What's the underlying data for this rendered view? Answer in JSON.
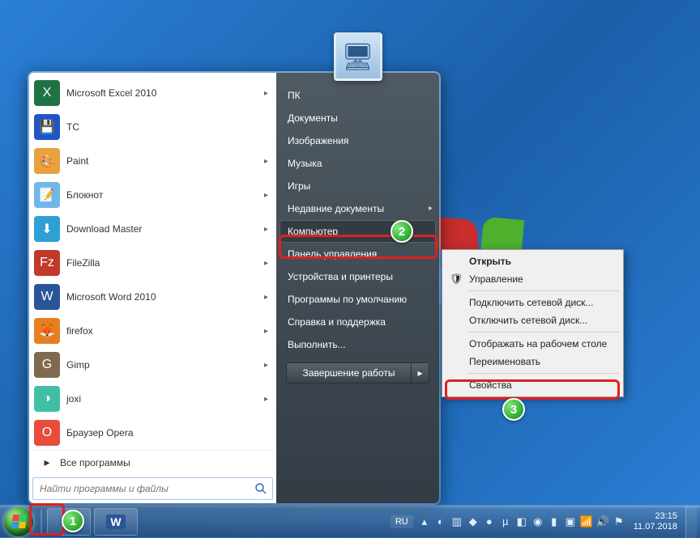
{
  "start_menu": {
    "programs": [
      {
        "label": "Microsoft Excel 2010",
        "icon_bg": "#1f7244",
        "icon_char": "X",
        "has_arrow": true
      },
      {
        "label": "TC",
        "icon_bg": "#1e55c7",
        "icon_char": "💾",
        "has_arrow": false
      },
      {
        "label": "Paint",
        "icon_bg": "#e8a13d",
        "icon_char": "🎨",
        "has_arrow": true
      },
      {
        "label": "Блокнот",
        "icon_bg": "#6fb7e8",
        "icon_char": "📝",
        "has_arrow": true
      },
      {
        "label": "Download Master",
        "icon_bg": "#2fa0d6",
        "icon_char": "⬇",
        "has_arrow": true
      },
      {
        "label": "FileZilla",
        "icon_bg": "#c0392b",
        "icon_char": "Fz",
        "has_arrow": true
      },
      {
        "label": "Microsoft Word 2010",
        "icon_bg": "#2a5699",
        "icon_char": "W",
        "has_arrow": true
      },
      {
        "label": "firefox",
        "icon_bg": "#e67e22",
        "icon_char": "🦊",
        "has_arrow": true
      },
      {
        "label": "Gimp",
        "icon_bg": "#7f6a4f",
        "icon_char": "G",
        "has_arrow": true
      },
      {
        "label": "joxi",
        "icon_bg": "#3fbfa6",
        "icon_char": "◑",
        "has_arrow": true
      },
      {
        "label": "Браузер Opera",
        "icon_bg": "#e74c3c",
        "icon_char": "O",
        "has_arrow": false
      }
    ],
    "all_programs_label": "Все программы",
    "search_placeholder": "Найти программы и файлы",
    "right_items": [
      {
        "label": "ПК",
        "highlighted": false
      },
      {
        "label": "Документы",
        "highlighted": false
      },
      {
        "label": "Изображения",
        "highlighted": false
      },
      {
        "label": "Музыка",
        "highlighted": false
      },
      {
        "label": "Игры",
        "highlighted": false
      },
      {
        "label": "Недавние документы",
        "highlighted": false,
        "has_submenu": true
      },
      {
        "label": "Компьютер",
        "highlighted": true
      },
      {
        "label": "Панель управления",
        "highlighted": false
      },
      {
        "label": "Устройства и принтеры",
        "highlighted": false
      },
      {
        "label": "Программы по умолчанию",
        "highlighted": false
      },
      {
        "label": "Справка и поддержка",
        "highlighted": false
      },
      {
        "label": "Выполнить...",
        "highlighted": false
      }
    ],
    "shutdown_label": "Завершение работы"
  },
  "context_menu": {
    "items": [
      {
        "label": "Открыть",
        "bold": true
      },
      {
        "label": "Управление",
        "icon": "🛡"
      },
      {
        "sep": true
      },
      {
        "label": "Подключить сетевой диск..."
      },
      {
        "label": "Отключить сетевой диск..."
      },
      {
        "sep": true
      },
      {
        "label": "Отображать на рабочем столе"
      },
      {
        "label": "Переименовать"
      },
      {
        "sep": true
      },
      {
        "label": "Свойства"
      }
    ]
  },
  "taskbar": {
    "lang": "RU",
    "time": "23:15",
    "date": "11.07.2018"
  },
  "steps": {
    "s1": "1",
    "s2": "2",
    "s3": "3"
  }
}
